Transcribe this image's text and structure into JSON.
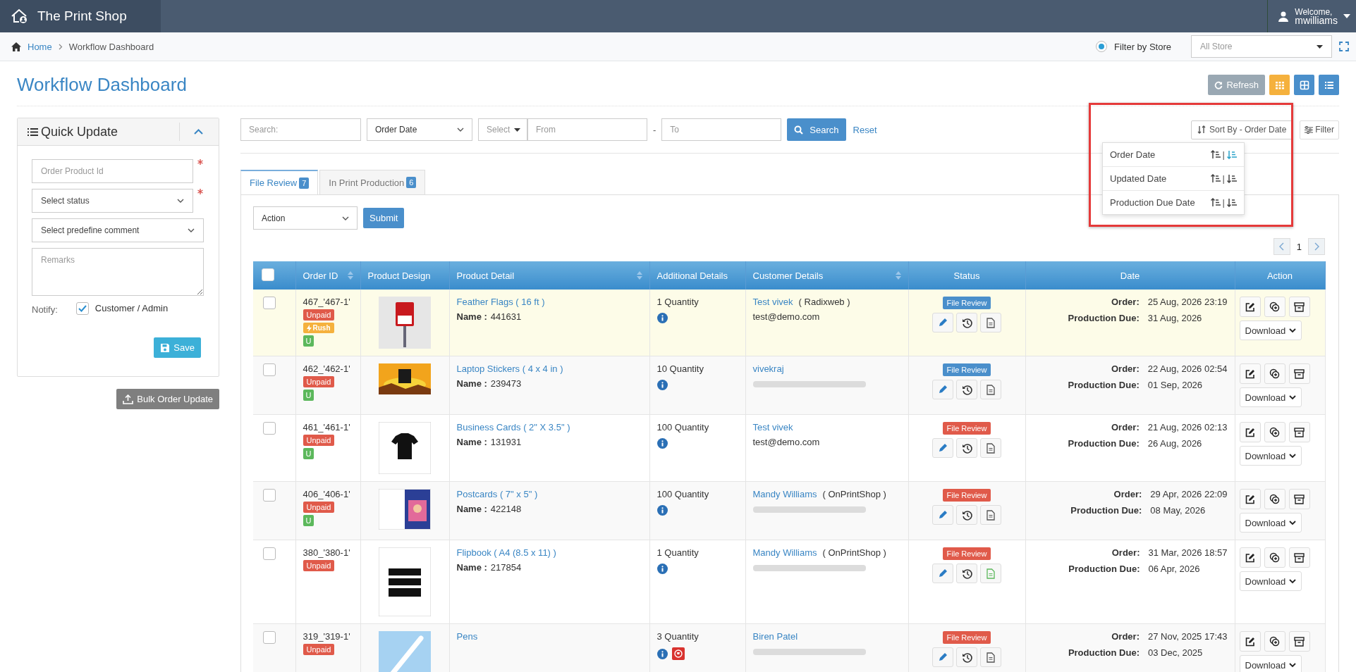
{
  "header": {
    "brand": "The Print Shop",
    "welcome": "Welcome,",
    "username": "mwilliams"
  },
  "breadcrumb": [
    {
      "label": "Home",
      "kind": "link"
    },
    {
      "label": "Workflow Dashboard",
      "kind": "current"
    }
  ],
  "store_filter": {
    "label": "Filter by Store",
    "selected": true,
    "placeholder": "All Store"
  },
  "page_title": "Workflow Dashboard",
  "toolbar": {
    "refresh": "Refresh",
    "views": [
      {
        "kind": "calendar",
        "color": "#f5b13d"
      },
      {
        "kind": "tiles",
        "color": "#4a8fcb"
      },
      {
        "kind": "list",
        "color": "#4a8fcb"
      }
    ]
  },
  "quick_update": {
    "title": "Quick Update",
    "expanded": true,
    "fields": [
      {
        "kind": "input",
        "placeholder": "Order Product Id",
        "required": true
      },
      {
        "kind": "select",
        "placeholder": "Select status",
        "required": true
      },
      {
        "kind": "select",
        "placeholder": "Select predefine comment",
        "required": false
      },
      {
        "kind": "textarea",
        "placeholder": "Remarks",
        "required": false
      }
    ],
    "notify_label": "Notify:",
    "notify_option": {
      "label": "Customer / Admin",
      "checked": true
    },
    "save": "Save",
    "bulk": "Bulk Order Update"
  },
  "filters": {
    "search_placeholder": "Search:",
    "date_field": "Order Date",
    "range_select": "Select",
    "from_placeholder": "From",
    "separator": "-",
    "to_placeholder": "To",
    "search_button": "Search",
    "reset": "Reset",
    "sort_button": "Sort By - Order Date",
    "filter_button": "Filter"
  },
  "sort_menu": [
    {
      "label": "Order Date",
      "asc_selected": false,
      "separator": "|",
      "desc_selected": true
    },
    {
      "label": "Updated Date",
      "asc_selected": false,
      "separator": "|",
      "desc_selected": false
    },
    {
      "label": "Production Due Date",
      "asc_selected": false,
      "separator": "|",
      "desc_selected": false
    }
  ],
  "tabs": [
    {
      "label": "File Review",
      "count": "7",
      "selected": true
    },
    {
      "label": "In Print Production",
      "count": "6",
      "selected": false
    }
  ],
  "bulk_action": {
    "placeholder": "Action",
    "submit": "Submit"
  },
  "pagination": [
    {
      "label": "1",
      "selected": true
    }
  ],
  "table": {
    "header_checked": false,
    "columns": [
      {
        "kind": "checkbox"
      },
      {
        "kind": "text",
        "label": "Order ID",
        "sortable": true
      },
      {
        "kind": "text",
        "label": "Product Design"
      },
      {
        "kind": "text",
        "label": "Product Detail",
        "sortable": true
      },
      {
        "kind": "text",
        "label": "Additional Details"
      },
      {
        "kind": "text",
        "label": "Customer Details",
        "sortable": true
      },
      {
        "kind": "center",
        "label": "Status"
      },
      {
        "kind": "center",
        "label": "Date"
      },
      {
        "kind": "center",
        "label": "Action"
      }
    ],
    "rows": [
      {
        "checked": false,
        "highlighted": true,
        "order_id": "467_'467-1'",
        "badges": [
          {
            "kind": "unpaid",
            "label": "Unpaid"
          },
          {
            "kind": "rush",
            "label": "Rush"
          },
          {
            "kind": "u",
            "label": "U"
          }
        ],
        "image": {
          "kind": "sign"
        },
        "product": "Feather Flags ( 16 ft )",
        "name_label": "Name :",
        "name_value": "441631",
        "quantity": "1 Quantity",
        "extras": [
          {
            "kind": "info"
          }
        ],
        "customer": "Test vivek",
        "company": "( Radixweb )",
        "email": "test@demo.com",
        "status": {
          "label": "File Review",
          "color": "#4a8fcb"
        },
        "note_attached": false,
        "order_label": "Order:",
        "order_date": "25 Aug, 2026 23:19",
        "due_label": "Production Due:",
        "due_date": "31 Aug, 2026",
        "download": "Download"
      },
      {
        "checked": false,
        "highlighted": false,
        "order_id": "462_'462-1'",
        "badges": [
          {
            "kind": "unpaid",
            "label": "Unpaid"
          },
          {
            "kind": "u",
            "label": "U"
          }
        ],
        "image": {
          "kind": "sunset"
        },
        "product": "Laptop Stickers ( 4 x 4 in )",
        "name_label": "Name :",
        "name_value": "239473",
        "quantity": "10 Quantity",
        "extras": [
          {
            "kind": "info"
          }
        ],
        "customer": "vivekraj",
        "email_blurred": true,
        "status": {
          "label": "File Review",
          "color": "#4a8fcb"
        },
        "note_attached": false,
        "order_label": "Order:",
        "order_date": "22 Aug, 2026 02:54",
        "due_label": "Production Due:",
        "due_date": "01 Sep, 2026",
        "download": "Download"
      },
      {
        "checked": false,
        "highlighted": false,
        "order_id": "461_'461-1'",
        "badges": [
          {
            "kind": "unpaid",
            "label": "Unpaid"
          },
          {
            "kind": "u",
            "label": "U"
          }
        ],
        "image": {
          "kind": "tshirt"
        },
        "product": "Business Cards ( 2\" X 3.5\" )",
        "name_label": "Name :",
        "name_value": "131931",
        "quantity": "100 Quantity",
        "extras": [
          {
            "kind": "info"
          }
        ],
        "customer": "Test vivek",
        "email": "test@demo.com",
        "status": {
          "label": "File Review",
          "color": "#e05a4a"
        },
        "note_attached": false,
        "order_label": "Order:",
        "order_date": "21 Aug, 2026 02:13",
        "due_label": "Production Due:",
        "due_date": "26 Aug, 2026",
        "download": "Download"
      },
      {
        "checked": false,
        "highlighted": false,
        "order_id": "406_'406-1'",
        "badges": [
          {
            "kind": "unpaid",
            "label": "Unpaid"
          },
          {
            "kind": "u",
            "label": "U"
          }
        ],
        "image": {
          "kind": "postcard"
        },
        "product": "Postcards ( 7\" x 5\" )",
        "name_label": "Name :",
        "name_value": "422148",
        "quantity": "100 Quantity",
        "extras": [
          {
            "kind": "info"
          }
        ],
        "customer": "Mandy Williams",
        "company": "( OnPrintShop )",
        "email_blurred": true,
        "status": {
          "label": "File Review",
          "color": "#e05a4a"
        },
        "note_attached": false,
        "order_label": "Order:",
        "order_date": "29 Apr, 2026 22:09",
        "due_label": "Production Due:",
        "due_date": "08 May, 2026",
        "download": "Download"
      },
      {
        "checked": false,
        "highlighted": false,
        "order_id": "380_'380-1'",
        "badges": [
          {
            "kind": "unpaid",
            "label": "Unpaid"
          }
        ],
        "image": {
          "kind": "poster"
        },
        "product": "Flipbook ( A4 (8.5 x 11) )",
        "name_label": "Name :",
        "name_value": "217854",
        "quantity": "1 Quantity",
        "extras": [
          {
            "kind": "info"
          }
        ],
        "customer": "Mandy Williams",
        "company": "( OnPrintShop )",
        "email_blurred": true,
        "status": {
          "label": "File Review",
          "color": "#e05a4a"
        },
        "note_attached": true,
        "order_label": "Order:",
        "order_date": "31 Mar, 2026 18:57",
        "due_label": "Production Due:",
        "due_date": "06 Apr, 2026",
        "download": "Download"
      },
      {
        "checked": false,
        "highlighted": false,
        "order_id": "319_'319-1'",
        "badges": [
          {
            "kind": "unpaid",
            "label": "Unpaid"
          }
        ],
        "image": {
          "kind": "pen"
        },
        "product": "Pens",
        "quantity": "3 Quantity",
        "extras": [
          {
            "kind": "info"
          },
          {
            "kind": "reorder"
          }
        ],
        "customer": "Biren Patel",
        "email_blurred": true,
        "status": {
          "label": "File Review",
          "color": "#e05a4a"
        },
        "note_attached": false,
        "order_label": "Order:",
        "order_date": "27 Nov, 2025 17:43",
        "due_label": "Production Due:",
        "due_date": "03 Dec, 2025",
        "download": "Download"
      }
    ]
  }
}
